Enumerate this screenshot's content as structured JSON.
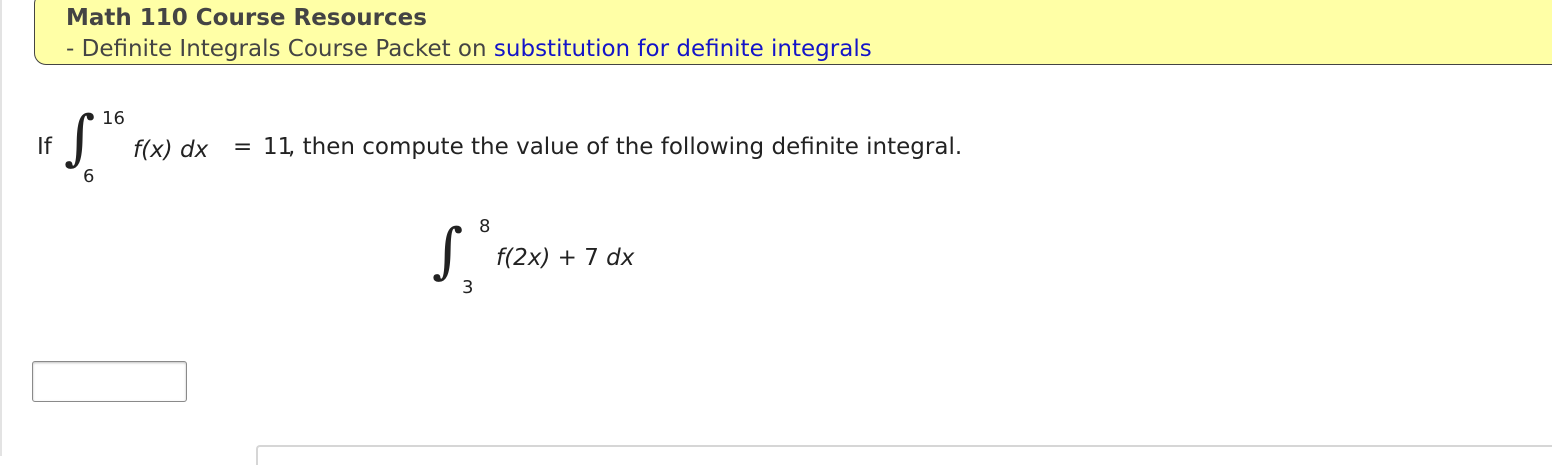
{
  "resources": {
    "title": "Math 110 Course Resources",
    "prefix": "- Definite Integrals Course Packet on ",
    "link_text": "substitution for definite integrals"
  },
  "problem": {
    "if_word": "If",
    "given_upper": "16",
    "given_lower": "6",
    "given_integrand": "f(x) dx",
    "equals": "=",
    "given_value": "11",
    "statement": ", then compute the value of the following definite integral.",
    "target_upper": "8",
    "target_lower": "3",
    "target_integrand_func": "f(2x)",
    "target_plus": "+",
    "target_const": "7",
    "target_dx": "dx"
  },
  "answer": {
    "value": ""
  },
  "icons": {
    "integral_sign": "∫"
  }
}
